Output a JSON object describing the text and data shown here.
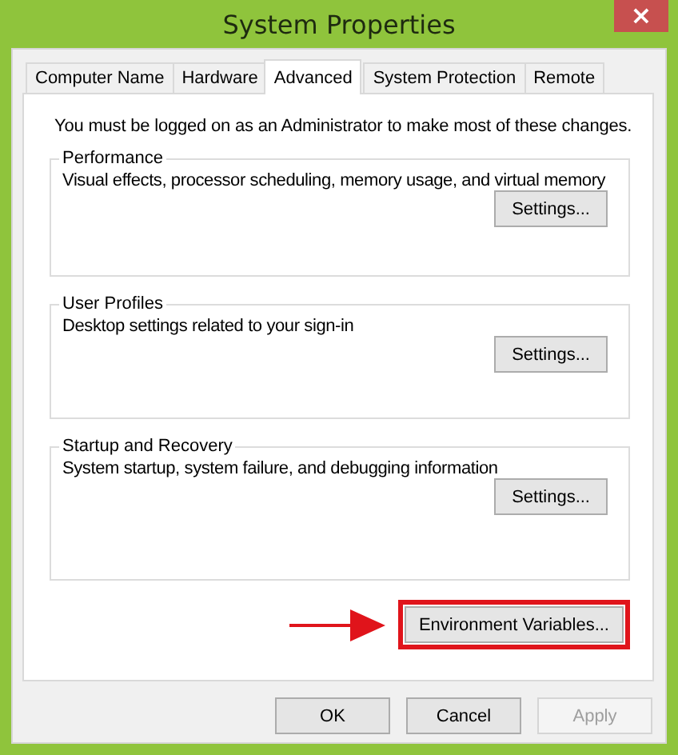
{
  "window": {
    "title": "System Properties",
    "close": "×"
  },
  "tabs": [
    {
      "label": "Computer Name",
      "selected": false
    },
    {
      "label": "Hardware",
      "selected": false
    },
    {
      "label": "Advanced",
      "selected": true
    },
    {
      "label": "System Protection",
      "selected": false
    },
    {
      "label": "Remote",
      "selected": false
    }
  ],
  "notice": "You must be logged on as an Administrator to make most of these changes.",
  "groups": [
    {
      "title": "Performance",
      "description": "Visual effects, processor scheduling, memory usage, and virtual memory",
      "button": "Settings..."
    },
    {
      "title": "User Profiles",
      "description": "Desktop settings related to your sign-in",
      "button": "Settings..."
    },
    {
      "title": "Startup and Recovery",
      "description": "System startup, system failure, and debugging information",
      "button": "Settings..."
    }
  ],
  "environment_button": {
    "label": "Environment Variables...",
    "highlighted": true
  },
  "buttons": [
    {
      "label": "OK",
      "disabled": false
    },
    {
      "label": "Cancel",
      "disabled": false
    },
    {
      "label": "Apply",
      "disabled": true
    }
  ]
}
